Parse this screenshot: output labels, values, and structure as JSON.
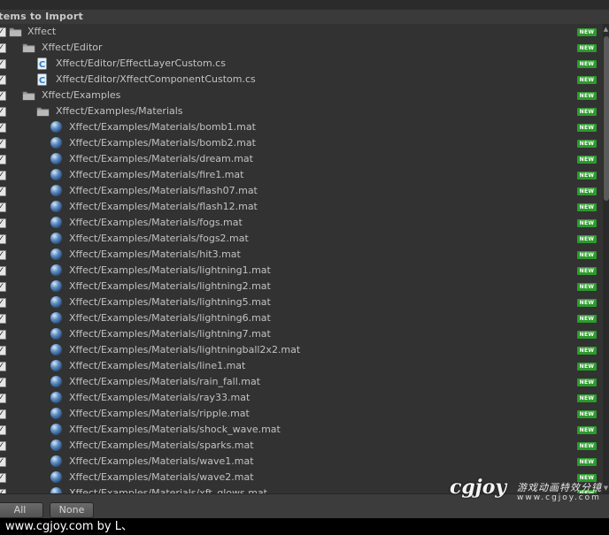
{
  "header": {
    "title": "Items to Import"
  },
  "badge_label": "NEW",
  "items": [
    {
      "type": "folder",
      "indent": 0,
      "label": "Xffect"
    },
    {
      "type": "folder",
      "indent": 1,
      "label": "Xffect/Editor"
    },
    {
      "type": "script",
      "indent": 2,
      "label": "Xffect/Editor/EffectLayerCustom.cs"
    },
    {
      "type": "script",
      "indent": 2,
      "label": "Xffect/Editor/XffectComponentCustom.cs"
    },
    {
      "type": "folder",
      "indent": 1,
      "label": "Xffect/Examples"
    },
    {
      "type": "folder",
      "indent": 2,
      "label": "Xffect/Examples/Materials"
    },
    {
      "type": "material",
      "indent": 3,
      "label": "Xffect/Examples/Materials/bomb1.mat"
    },
    {
      "type": "material",
      "indent": 3,
      "label": "Xffect/Examples/Materials/bomb2.mat"
    },
    {
      "type": "material",
      "indent": 3,
      "label": "Xffect/Examples/Materials/dream.mat"
    },
    {
      "type": "material",
      "indent": 3,
      "label": "Xffect/Examples/Materials/fire1.mat"
    },
    {
      "type": "material",
      "indent": 3,
      "label": "Xffect/Examples/Materials/flash07.mat"
    },
    {
      "type": "material",
      "indent": 3,
      "label": "Xffect/Examples/Materials/flash12.mat"
    },
    {
      "type": "material",
      "indent": 3,
      "label": "Xffect/Examples/Materials/fogs.mat"
    },
    {
      "type": "material",
      "indent": 3,
      "label": "Xffect/Examples/Materials/fogs2.mat"
    },
    {
      "type": "material",
      "indent": 3,
      "label": "Xffect/Examples/Materials/hit3.mat"
    },
    {
      "type": "material",
      "indent": 3,
      "label": "Xffect/Examples/Materials/lightning1.mat"
    },
    {
      "type": "material",
      "indent": 3,
      "label": "Xffect/Examples/Materials/lightning2.mat"
    },
    {
      "type": "material",
      "indent": 3,
      "label": "Xffect/Examples/Materials/lightning5.mat"
    },
    {
      "type": "material",
      "indent": 3,
      "label": "Xffect/Examples/Materials/lightning6.mat"
    },
    {
      "type": "material",
      "indent": 3,
      "label": "Xffect/Examples/Materials/lightning7.mat"
    },
    {
      "type": "material",
      "indent": 3,
      "label": "Xffect/Examples/Materials/lightningball2x2.mat"
    },
    {
      "type": "material",
      "indent": 3,
      "label": "Xffect/Examples/Materials/line1.mat"
    },
    {
      "type": "material",
      "indent": 3,
      "label": "Xffect/Examples/Materials/rain_fall.mat"
    },
    {
      "type": "material",
      "indent": 3,
      "label": "Xffect/Examples/Materials/ray33.mat"
    },
    {
      "type": "material",
      "indent": 3,
      "label": "Xffect/Examples/Materials/ripple.mat"
    },
    {
      "type": "material",
      "indent": 3,
      "label": "Xffect/Examples/Materials/shock_wave.mat"
    },
    {
      "type": "material",
      "indent": 3,
      "label": "Xffect/Examples/Materials/sparks.mat"
    },
    {
      "type": "material",
      "indent": 3,
      "label": "Xffect/Examples/Materials/wave1.mat"
    },
    {
      "type": "material",
      "indent": 3,
      "label": "Xffect/Examples/Materials/wave2.mat"
    },
    {
      "type": "material",
      "indent": 3,
      "label": "Xffect/Examples/Materials/xft_glows.mat"
    }
  ],
  "footer": {
    "all_label": "All",
    "none_label": "None"
  },
  "logo": {
    "main": "cgjoy",
    "cn": "游戏动画特效分镜",
    "url": "www.cgjoy.com"
  },
  "watermark": "www.cgjoy.com by L、",
  "colors": {
    "badge": "#2d9a2d",
    "background": "#323232",
    "text": "#c2c2c2"
  }
}
